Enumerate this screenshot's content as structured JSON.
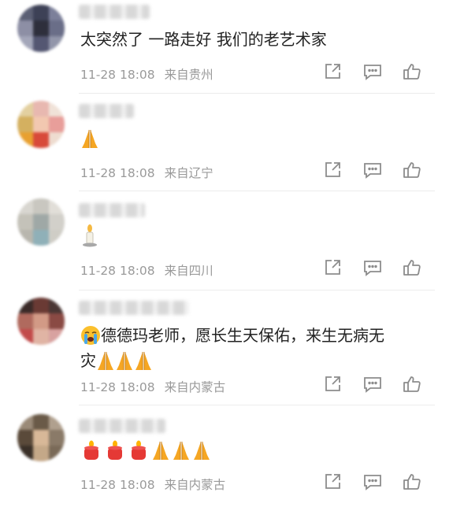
{
  "comments": [
    {
      "text": "太突然了 一路走好 我们的老艺术家",
      "date": "11-28 18:08",
      "location": "来自贵州",
      "emoji": []
    },
    {
      "text": "",
      "date": "11-28 18:08",
      "location": "来自辽宁",
      "emoji": [
        "pray"
      ]
    },
    {
      "text": "",
      "date": "11-28 18:08",
      "location": "来自四川",
      "emoji": [
        "candle"
      ]
    },
    {
      "text_line1": "德德玛老师，愿长生天保佑，来生无病无",
      "text_line2": "灾",
      "date": "11-28 18:08",
      "location": "来自内蒙古",
      "emoji": [
        "crying",
        "pray",
        "pray",
        "pray"
      ]
    },
    {
      "text": "",
      "date": "11-28 18:08",
      "location": "来自内蒙古",
      "emoji": [
        "red-candle",
        "red-candle",
        "red-candle",
        "pray",
        "pray",
        "pray"
      ]
    }
  ],
  "actions": {
    "share_icon": "share-icon",
    "comment_icon": "comment-icon",
    "like_icon": "like-icon"
  },
  "colors": {
    "meta": "#9a9a9a",
    "text": "#222222",
    "icon": "#8c8c8c",
    "pray": "#f5a623"
  }
}
